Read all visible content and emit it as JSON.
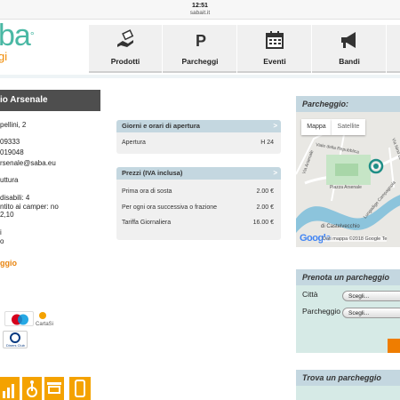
{
  "status_bar": {
    "time": "12:51",
    "url": "sabait.it"
  },
  "brand": {
    "logo_text": "ba",
    "logo_sub": "gi",
    "accent": "#4ab8a4",
    "orange": "#f08a00"
  },
  "nav": {
    "items": [
      {
        "label": "Prodotti",
        "icon": "hand-card-icon"
      },
      {
        "label": "Parcheggi",
        "icon": "parking-p-icon"
      },
      {
        "label": "Eventi",
        "icon": "calendar-icon"
      },
      {
        "label": "Bandi",
        "icon": "megaphone-icon"
      }
    ]
  },
  "page_title": "io Arsenale",
  "info": {
    "address": "pellini, 2",
    "phone": "09333",
    "fax": "019048",
    "email": "rsenale@saba.eu",
    "blank": "",
    "coverage": "uttura",
    "disabled": "disabili: 4",
    "camper": "ntito ai camper: no",
    "height": "2,10",
    "l1": "i",
    "l2": "o"
  },
  "parcheggio_link": "ggio",
  "cards": [
    "Maestro",
    "CartaSi",
    "Diners Club"
  ],
  "hours_panel": {
    "title": "Giorni e orari di apertura",
    "rows": [
      {
        "label": "Apertura",
        "value": "H 24"
      }
    ]
  },
  "prices_panel": {
    "title": "Prezzi (IVA inclusa)",
    "rows": [
      {
        "label": "Prima ora di sosta",
        "value": "2.00 €"
      },
      {
        "label": "Per ogni ora successiva o frazione",
        "value": "2.00 €"
      },
      {
        "label": "Tariffa Giornaliera",
        "value": "16.00 €"
      }
    ]
  },
  "right": {
    "parcheggio_title": "Parcheggio:",
    "map_tabs": [
      "Mappa",
      "Satellite"
    ],
    "map_labels": {
      "street1": "Viale della Repubblica",
      "street2": "Via Arsenale",
      "place": "Piazza Arsenale",
      "street3": "Lungadige Campagnola",
      "street4": "Via Nino Bixio",
      "castle": "di Castelvecchio"
    },
    "google": "Google",
    "map_credit": "Dati mappa ©2018 Google",
    "map_credit_tail": "Te",
    "prenota_title": "Prenota un parcheggio",
    "city_label": "Città",
    "parking_label": "Parcheggio",
    "select_placeholder": "Scegli...",
    "trova_title": "Trova un parcheggio"
  }
}
